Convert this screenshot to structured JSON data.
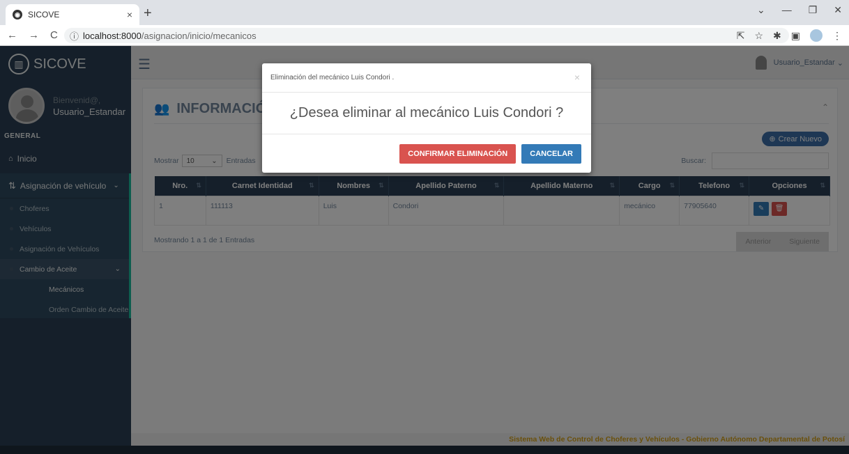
{
  "browser": {
    "tab_title": "SICOVE",
    "tab_close": "×",
    "new_tab": "+",
    "url_host": "localhost:8000",
    "url_path": "/asignacion/inicio/mecanicos",
    "window_controls": [
      "⌄",
      "—",
      "❐",
      "✕"
    ]
  },
  "sidebar": {
    "brand": "SICOVE",
    "welcome": "Bienvenid@,",
    "username": "Usuario_Estandar",
    "section": "GENERAL",
    "inicio": "Inicio",
    "asignacion": "Asignación de vehículo",
    "items": [
      {
        "label": "Choferes"
      },
      {
        "label": "Vehículos"
      },
      {
        "label": "Asignación de Vehículos"
      },
      {
        "label": "Cambio de Aceite"
      }
    ],
    "subitems": [
      {
        "label": "Mecánicos"
      },
      {
        "label": "Orden Cambio de Aceite"
      }
    ]
  },
  "topbar": {
    "user": "Usuario_Estandar"
  },
  "panel": {
    "title": "INFORMACIÓ",
    "create_button": "Crear Nuevo",
    "show_label": "Mostrar",
    "show_value": "10",
    "entries_label": "Entradas",
    "search_label": "Buscar:",
    "info": "Mostrando 1 a 1 de 1 Entradas",
    "prev": "Anterior",
    "next": "Siguiente"
  },
  "table": {
    "headers": [
      "Nro.",
      "Carnet Identidad",
      "Nombres",
      "Apellido Paterno",
      "Apellido Materno",
      "Cargo",
      "Telefono",
      "Opciones"
    ],
    "rows": [
      [
        "1",
        "111113",
        "Luis",
        "Condori",
        "",
        "mecánico",
        "77905640"
      ]
    ]
  },
  "modal": {
    "title": "Eliminación del mecánico Luis Condori .",
    "close": "×",
    "message": "¿Desea eliminar al mecánico Luis Condori ?",
    "confirm": "CONFIRMAR ELIMINACIÓN",
    "cancel": "CANCELAR"
  },
  "footer": {
    "text": "Sistema Web de Control de Choferes y Vehículos - Gobierno Autónomo Departamental de Potosí"
  },
  "colors": {
    "sidebar": "#2a3f54",
    "accent": "#1abb9c",
    "danger": "#d9534f",
    "primary": "#337ab7",
    "footer_text": "#d4a017"
  }
}
